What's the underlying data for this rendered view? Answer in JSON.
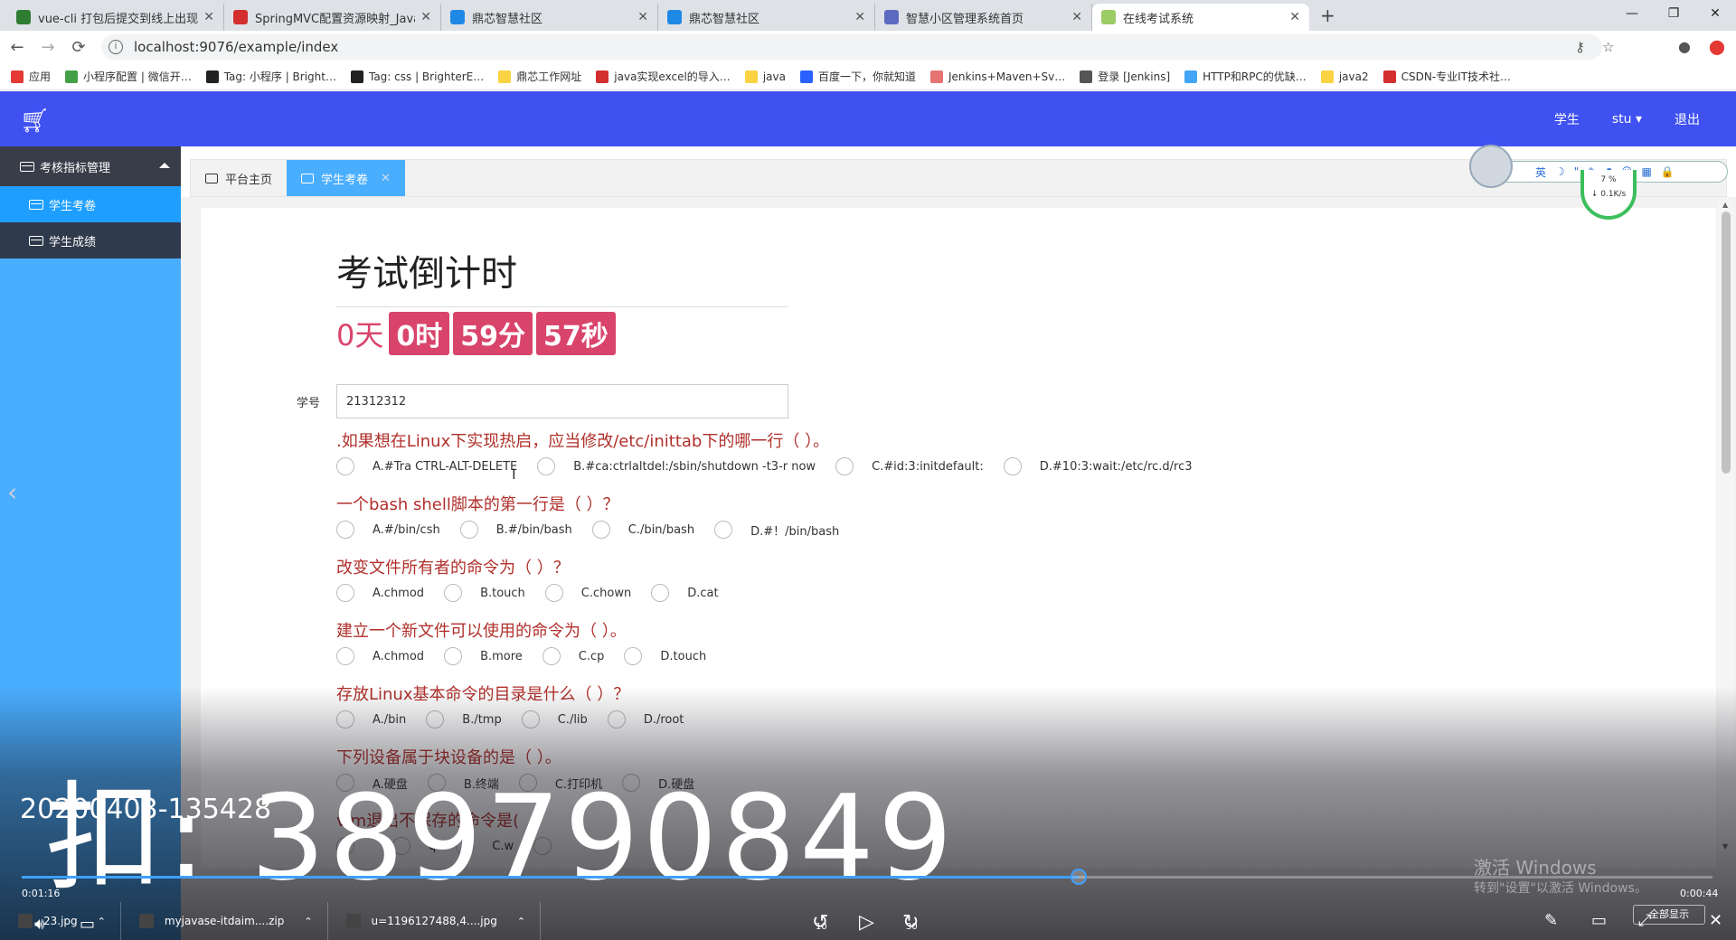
{
  "browser": {
    "tabs": [
      {
        "label": "vue-cli 打包后提交到线上出现 \"(",
        "color": "#2e7d32"
      },
      {
        "label": "SpringMVC配置资源映射_Java_",
        "color": "#d32f2f"
      },
      {
        "label": "鼎芯智慧社区",
        "color": "#1e88e5"
      },
      {
        "label": "鼎芯智慧社区",
        "color": "#1e88e5"
      },
      {
        "label": "智慧小区管理系统首页",
        "color": "#5c6bc0"
      },
      {
        "label": "在线考试系统",
        "color": "#9ccc65"
      }
    ],
    "new_tab": "+",
    "window_controls": {
      "minimize": "—",
      "maximize": "❐",
      "close": "✕"
    },
    "back": "←",
    "forward": "→",
    "reload": "⟳",
    "url": "localhost:9076/example/index",
    "bookmarks": [
      {
        "label": "应用",
        "color": "#e53935"
      },
      {
        "label": "小程序配置 | 微信开…",
        "color": "#43a047"
      },
      {
        "label": "Tag: 小程序 | Bright…",
        "color": "#222222"
      },
      {
        "label": "Tag: css | BrighterE…",
        "color": "#222222"
      },
      {
        "label": "鼎芯工作网址",
        "color": "#f9d342"
      },
      {
        "label": "java实现excel的导入…",
        "color": "#d32f2f"
      },
      {
        "label": "java",
        "color": "#f9d342"
      },
      {
        "label": "百度一下，你就知道",
        "color": "#2962ff"
      },
      {
        "label": "Jenkins+Maven+Sv…",
        "color": "#e57373"
      },
      {
        "label": "登录 [Jenkins]",
        "color": "#555555"
      },
      {
        "label": "HTTP和RPC的优缺…",
        "color": "#42a5f5"
      },
      {
        "label": "java2",
        "color": "#f9d342"
      },
      {
        "label": "CSDN-专业IT技术社…",
        "color": "#d32f2f"
      }
    ]
  },
  "header": {
    "logo_icon": "cart-icon",
    "nav": {
      "role": "学生",
      "user": "stu ▾",
      "logout": "退出"
    },
    "color": "#3f51f0"
  },
  "sidebar": {
    "group": "考核指标管理",
    "items": [
      {
        "label": "学生考卷",
        "active": true
      },
      {
        "label": "学生成绩",
        "active": false
      }
    ]
  },
  "page_tabs": [
    {
      "label": "平台主页",
      "active": false
    },
    {
      "label": "学生考卷",
      "active": true,
      "close": "✕"
    }
  ],
  "exam": {
    "title": "考试倒计时",
    "countdown": {
      "days": "0天",
      "hours": "0时",
      "minutes": "59分",
      "seconds": "57秒"
    },
    "student_id_label": "学号",
    "student_id_value": "21312312",
    "questions": [
      {
        "text": ".如果想在Linux下实现热启，应当修改/etc/inittab下的哪一行（ ）。",
        "options": [
          "A.#Tra CTRL-ALT-DELETE",
          "B.#ca:ctrlaltdel:/sbin/shutdown -t3-r now",
          "C.#id:3:initdefault:",
          "D.#10:3:wait:/etc/rc.d/rc3"
        ]
      },
      {
        "text": "一个bash shell脚本的第一行是（ ）？",
        "options": [
          "A.#/bin/csh",
          "B.#/bin/bash",
          "C./bin/bash",
          "D.#！/bin/bash"
        ]
      },
      {
        "text": "改变文件所有者的命令为（ ）？",
        "options": [
          "A.chmod",
          "B.touch",
          "C.chown",
          "D.cat"
        ]
      },
      {
        "text": "建立一个新文件可以使用的命令为（ ）。",
        "options": [
          "A.chmod",
          "B.more",
          "C.cp",
          "D.touch"
        ]
      },
      {
        "text": "存放Linux基本命令的目录是什么（ ）？",
        "options": [
          "A./bin",
          "B./tmp",
          "C./lib",
          "D./root"
        ]
      },
      {
        "text": "下列设备属于块设备的是（ ）。",
        "options": [
          "A.硬盘",
          "B.终端",
          "C.打印机",
          "D.硬盘"
        ]
      },
      {
        "text": "vim退出不保存的命令是(",
        "options": [
          "",
          "q",
          "C.w",
          ""
        ]
      }
    ]
  },
  "float_widget": {
    "icons": [
      "英",
      "☽",
      "\"",
      "✎",
      "▮",
      "☺",
      "▦",
      "🔒"
    ],
    "net_percent": "7 %",
    "net_speed": "↓ 0.1K/s"
  },
  "video_overlay": {
    "timestamp": "20200403-135428",
    "watermark": "扣: 389790849",
    "progress_fraction": 0.625,
    "time_elapsed": "0:01:16",
    "time_total": "0:00:44",
    "activate_title": "激活 Windows",
    "activate_sub": "转到\"设置\"以激活 Windows。",
    "downloads": [
      {
        "label": "23.jpg"
      },
      {
        "label": "myjavase-itdaim....zip"
      },
      {
        "label": "u=1196127488,4....jpg"
      }
    ],
    "controls": {
      "rewind": "↺",
      "rewind_label": "10",
      "play": "▷",
      "forward": "↻",
      "forward_label": "30"
    },
    "show_all": "全部显示"
  }
}
